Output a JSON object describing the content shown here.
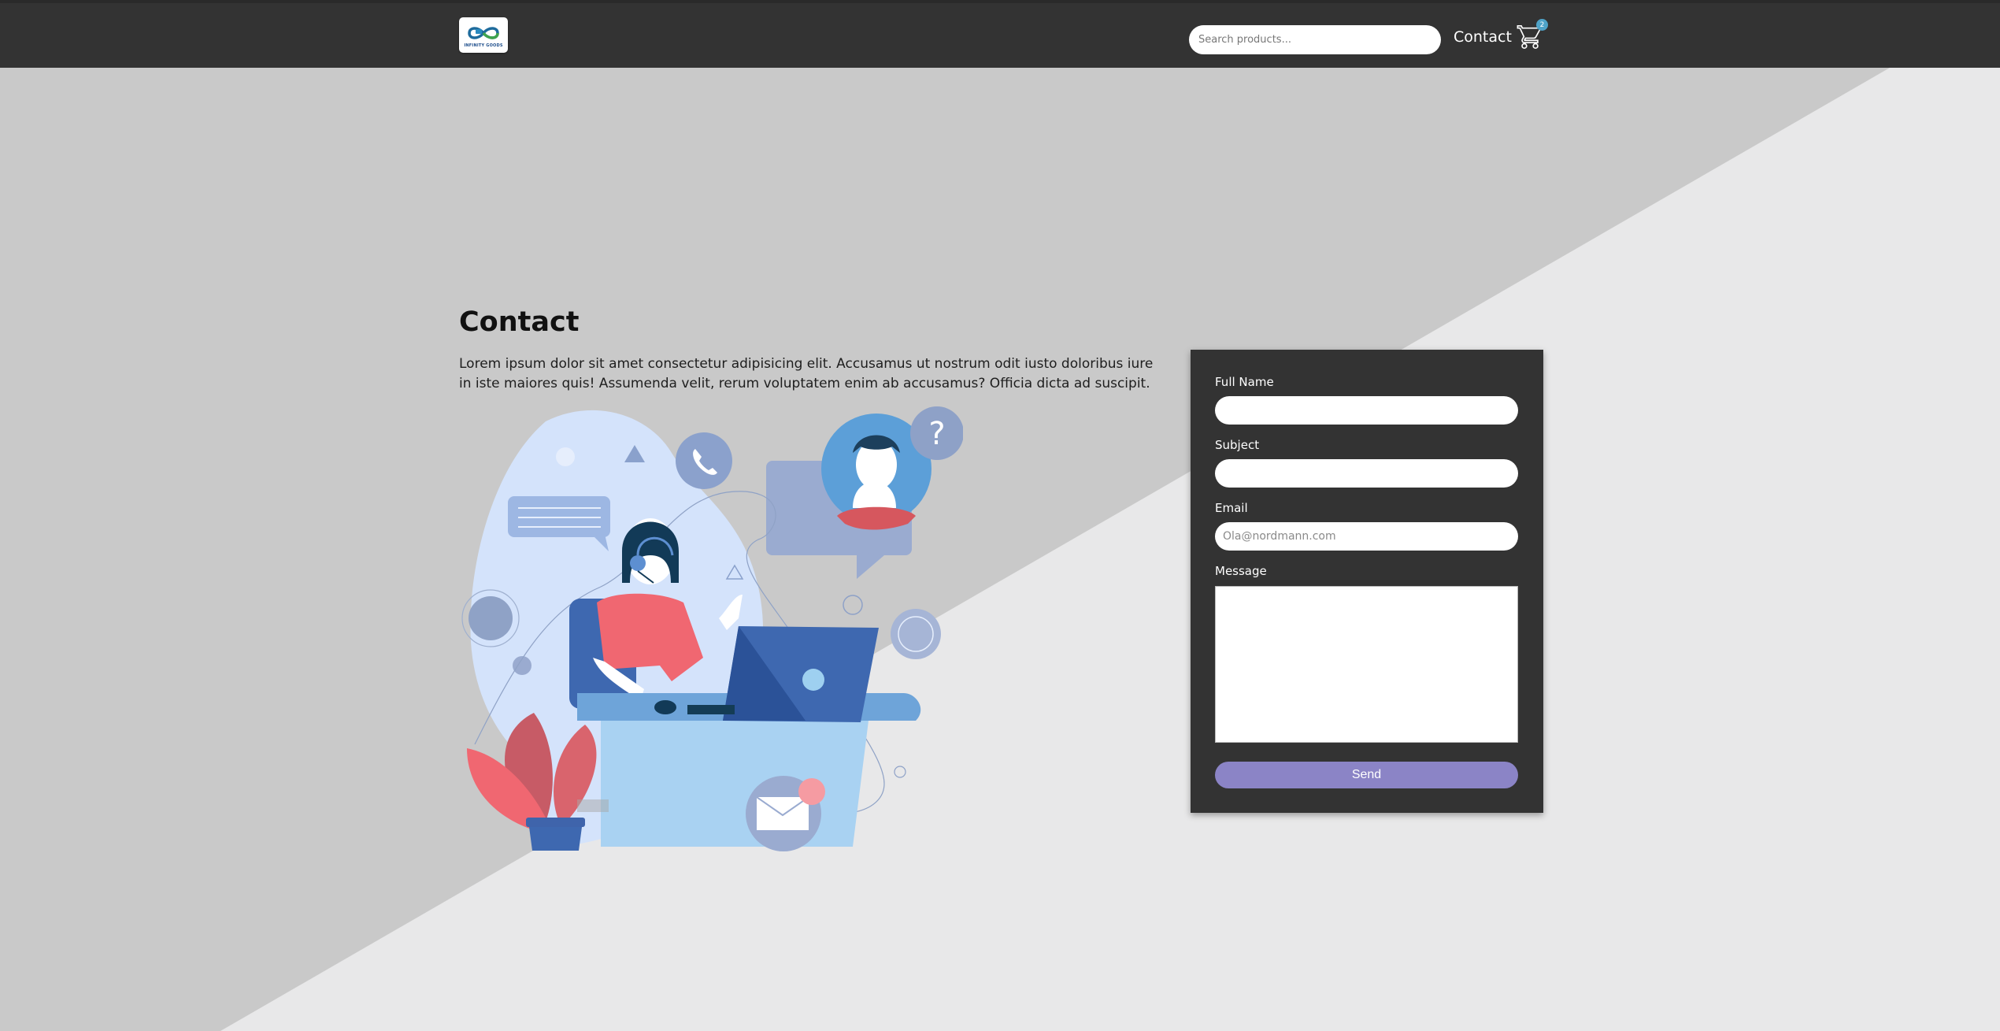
{
  "header": {
    "logo_text": "INFINITY GOODS",
    "search_placeholder": "Search products...",
    "nav_contact": "Contact",
    "cart_count": "2"
  },
  "main": {
    "title": "Contact",
    "intro": "Lorem ipsum dolor sit amet consectetur adipisicing elit. Accusamus ut nostrum odit iusto doloribus iure in iste maiores quis! Assumenda velit, rerum voluptatem enim ab accusamus? Officia dicta ad suscipit."
  },
  "form": {
    "full_name_label": "Full Name",
    "subject_label": "Subject",
    "email_label": "Email",
    "email_placeholder": "Ola@nordmann.com",
    "message_label": "Message",
    "send_label": "Send"
  },
  "colors": {
    "header_bg": "#333333",
    "page_bg_light": "#e8e8e9",
    "page_bg_dark": "#c9c9c9",
    "panel_bg": "#333333",
    "button": "#8b84c6",
    "badge": "#4fa3c8"
  },
  "icons": {
    "cart": "cart-icon",
    "logo": "infinity-logo-icon"
  }
}
